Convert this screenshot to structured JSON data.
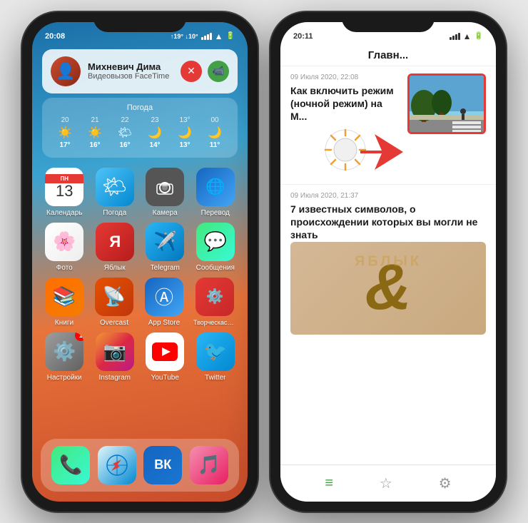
{
  "phone1": {
    "status": {
      "time": "20:08",
      "temp_high": "↑19°",
      "temp_low": "↓10°"
    },
    "notification": {
      "name": "Михневич Дима",
      "subtitle": "Видеовызов FaceTime"
    },
    "weather_widget": {
      "title": "Погода",
      "days": [
        {
          "day": "20",
          "icon": "☀️",
          "temp": "17°",
          "high": ""
        },
        {
          "day": "21",
          "icon": "☀️",
          "temp": "16°",
          "high": ""
        },
        {
          "day": "22",
          "icon": "🌤",
          "temp": "16°",
          "high": ""
        },
        {
          "day": "23",
          "icon": "🌙",
          "temp": "14°",
          "high": ""
        },
        {
          "day": "13°",
          "icon": "🌙",
          "temp": "13°",
          "high": ""
        },
        {
          "day": "00",
          "icon": "🌙",
          "temp": "11°",
          "high": ""
        }
      ]
    },
    "apps_row1": [
      {
        "label": "Календарь",
        "color": "calendar"
      },
      {
        "label": "Погода",
        "color": "weather"
      },
      {
        "label": "Камера",
        "color": "camera"
      },
      {
        "label": "Перевод",
        "color": "translate"
      }
    ],
    "apps_row2": [
      {
        "label": "Фото",
        "color": "photos"
      },
      {
        "label": "Яблык",
        "color": "yablyk"
      },
      {
        "label": "Telegram",
        "color": "telegram"
      },
      {
        "label": "Сообщения",
        "color": "messages"
      }
    ],
    "apps_row3": [
      {
        "label": "Книги",
        "color": "books"
      },
      {
        "label": "Overcast",
        "color": "overcast"
      },
      {
        "label": "App Store",
        "color": "appstore"
      },
      {
        "label": "Творческасту...",
        "color": "creative"
      }
    ],
    "apps_row4": [
      {
        "label": "Настройки",
        "color": "settings",
        "badge": "1"
      },
      {
        "label": "Instagram",
        "color": "instagram"
      },
      {
        "label": "YouTube",
        "color": "youtube"
      },
      {
        "label": "Twitter",
        "color": "twitter"
      }
    ],
    "dock": [
      {
        "label": "Телефон",
        "color": "phone"
      },
      {
        "label": "Safari",
        "color": "safari"
      },
      {
        "label": "ВКонтакте",
        "color": "vk"
      },
      {
        "label": "Музыка",
        "color": "music"
      }
    ]
  },
  "phone2": {
    "status": {
      "time": "20:11"
    },
    "nav_title": "Главн...",
    "article1": {
      "date": "09 Июля 2020, 22:08",
      "title": "Как включить режим (ночной режим) на М..."
    },
    "article2": {
      "date": "09 Июля 2020, 21:37",
      "title": "7 известных символов, о происхождении которых вы могли не знать"
    },
    "watermark": "ЯБЛЫК",
    "tabs": [
      "≡",
      "☆",
      "⚙"
    ]
  }
}
